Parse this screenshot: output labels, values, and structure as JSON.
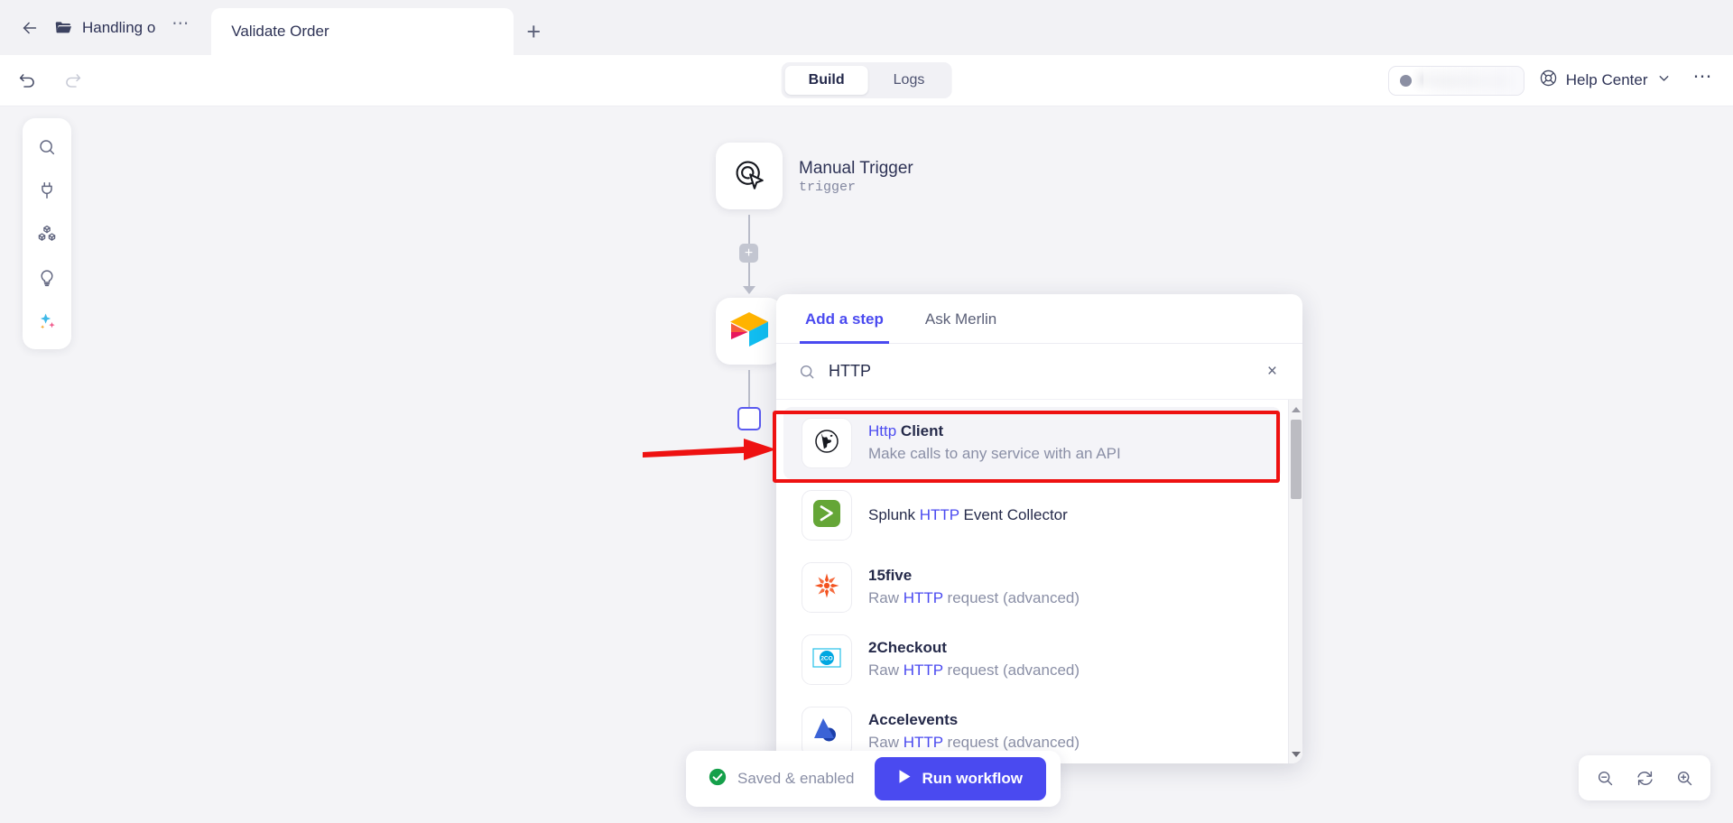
{
  "tabstrip": {
    "back_icon": "back-arrow-icon",
    "folder_icon": "folder-icon",
    "folder_name": "Handling o",
    "folder_menu": "⋯",
    "tab_label": "Validate Order",
    "add_tab": "+"
  },
  "header": {
    "undo_icon": "undo-icon",
    "redo_icon": "redo-icon",
    "tabs": [
      {
        "label": "Build",
        "active": true
      },
      {
        "label": "Logs",
        "active": false
      }
    ],
    "environment": {
      "name": "Production env",
      "dot_color": "#8b8fa3"
    },
    "help_center": "Help Center",
    "help_icon": "lifebuoy-icon",
    "chevron": "chevron-down-icon",
    "overflow_menu": "⋯"
  },
  "left_toolbar": {
    "items": [
      {
        "name": "search-icon",
        "label": "Search"
      },
      {
        "name": "plug-icon",
        "label": "Connections"
      },
      {
        "name": "blocks-icon",
        "label": "Blocks"
      },
      {
        "name": "lightbulb-icon",
        "label": "Ideas"
      },
      {
        "name": "sparkle-icon",
        "label": "AI Assistant"
      }
    ]
  },
  "canvas": {
    "nodes": [
      {
        "title": "Manual Trigger",
        "subtitle": "trigger",
        "icon": "click-target-icon"
      },
      {
        "title": "",
        "subtitle": "",
        "icon": "cube-logo-icon"
      }
    ],
    "connector_plus": "+",
    "add_node_square": "add-node-square"
  },
  "panel": {
    "tabs": [
      {
        "label": "Add a step",
        "active": true
      },
      {
        "label": "Ask Merlin",
        "active": false
      }
    ],
    "search": {
      "value": "HTTP",
      "placeholder": "Search",
      "clear": "×"
    },
    "results": [
      {
        "name_prefix": "",
        "name_match": "Http",
        "name_suffix": " Client",
        "desc_prefix": "Make calls to any service with an API",
        "desc_match": "",
        "desc_suffix": "",
        "icon": "globe-icon",
        "selected": true
      },
      {
        "name_prefix": "Splunk ",
        "name_match": "HTTP",
        "name_suffix": " Event Collector",
        "desc_prefix": "",
        "desc_match": "",
        "desc_suffix": "",
        "icon": "splunk-icon",
        "selected": false
      },
      {
        "name_prefix": "15five",
        "name_match": "",
        "name_suffix": "",
        "desc_prefix": "Raw ",
        "desc_match": "HTTP",
        "desc_suffix": " request (advanced)",
        "icon": "fifteenfive-icon",
        "selected": false
      },
      {
        "name_prefix": "2Checkout",
        "name_match": "",
        "name_suffix": "",
        "desc_prefix": "Raw ",
        "desc_match": "HTTP",
        "desc_suffix": " request (advanced)",
        "icon": "twocheckout-icon",
        "selected": false
      },
      {
        "name_prefix": "Accelevents",
        "name_match": "",
        "name_suffix": "",
        "desc_prefix": "Raw ",
        "desc_match": "HTTP",
        "desc_suffix": " request (advanced)",
        "icon": "accelevents-icon",
        "selected": false
      }
    ]
  },
  "annotation": {
    "color": "#ee1111",
    "target": "Http Client result row"
  },
  "bottom_bar": {
    "status_icon": "check-circle-icon",
    "status_text": "Saved & enabled",
    "run_label": "Run workflow",
    "run_icon": "play-icon",
    "accent": "#4a4af0"
  },
  "zoom_controls": [
    {
      "name": "zoom-out-icon"
    },
    {
      "name": "reset-view-icon"
    },
    {
      "name": "zoom-in-icon"
    }
  ]
}
